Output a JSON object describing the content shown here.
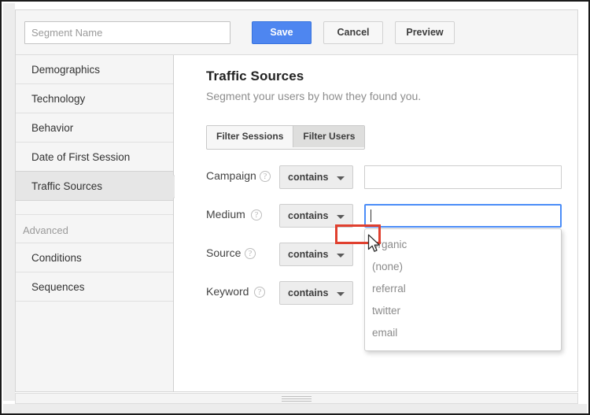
{
  "toolbar": {
    "segment_name_placeholder": "Segment Name",
    "segment_name_value": "",
    "save_label": "Save",
    "cancel_label": "Cancel",
    "preview_label": "Preview",
    "save_color": "#4e86f0"
  },
  "sidebar": {
    "items": [
      {
        "label": "Demographics",
        "selected": false
      },
      {
        "label": "Technology",
        "selected": false
      },
      {
        "label": "Behavior",
        "selected": false
      },
      {
        "label": "Date of First Session",
        "selected": false
      },
      {
        "label": "Traffic Sources",
        "selected": true
      }
    ],
    "section_label": "Advanced",
    "advanced_items": [
      {
        "label": "Conditions",
        "selected": false
      },
      {
        "label": "Sequences",
        "selected": false
      }
    ]
  },
  "content": {
    "title": "Traffic Sources",
    "subtitle": "Segment your users by how they found you.",
    "filter_toggle": {
      "sessions_label": "Filter Sessions",
      "users_label": "Filter Users",
      "active": "Filter Users"
    },
    "rows": [
      {
        "label": "Campaign",
        "help": "?",
        "operator": "contains",
        "value": "",
        "focused": false
      },
      {
        "label": "Medium",
        "help": "?",
        "operator": "contains",
        "value": "",
        "focused": true
      },
      {
        "label": "Source",
        "help": "?",
        "operator": "contains",
        "value": "",
        "focused": false
      },
      {
        "label": "Keyword",
        "help": "?",
        "operator": "contains",
        "value": "",
        "focused": false
      }
    ],
    "autocomplete": {
      "items": [
        "organic",
        "(none)",
        "referral",
        "twitter",
        "email"
      ],
      "highlighted": "organic",
      "highlight_color": "#e0402f"
    }
  }
}
